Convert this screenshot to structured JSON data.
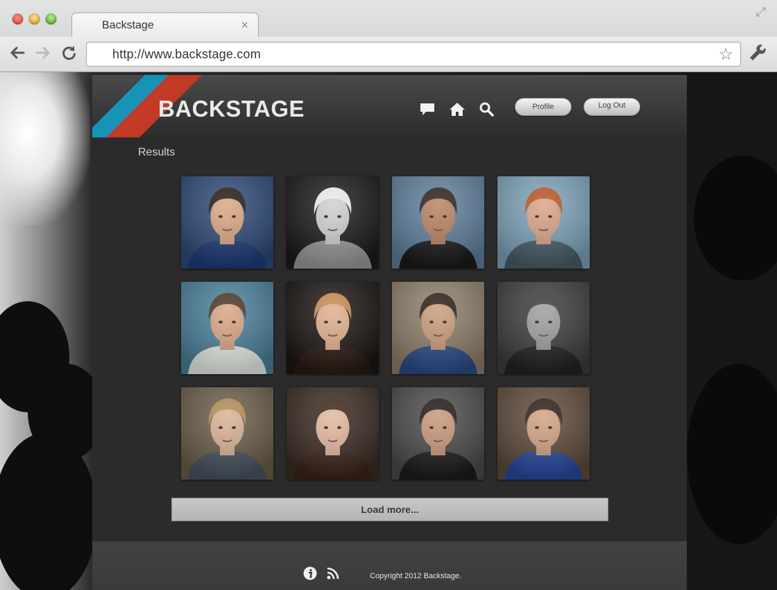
{
  "browser": {
    "tab_title": "Backstage",
    "tab_close": "×",
    "url": "http://www.backstage.com"
  },
  "header": {
    "logo": "BACKSTAGE",
    "profile_label": "Profile",
    "logout_label": "Log Out",
    "icons": [
      "chat-icon",
      "home-icon",
      "search-icon"
    ]
  },
  "main": {
    "title": "Results",
    "photos": [
      {
        "bg": "#2d4a78",
        "skin": "#d9a57f",
        "hair": "#1f1610",
        "shirt": "#1e3a78"
      },
      {
        "bg": "#1a1a1a",
        "skin": "#cfcfcf",
        "hair": "#eeeeee",
        "shirt": "#9a9a9a"
      },
      {
        "bg": "#5f7f9c",
        "skin": "#b77f5d",
        "hair": "#2a1d16",
        "shirt": "#1a1a1a"
      },
      {
        "bg": "#7da3b8",
        "skin": "#d9a283",
        "hair": "#b8531f",
        "shirt": "#4a5c68"
      },
      {
        "bg": "#4a7f99",
        "skin": "#d9a37f",
        "hair": "#4a3222",
        "shirt": "#e8efe6"
      },
      {
        "bg": "#1b1512",
        "skin": "#e0ad8a",
        "hair": "#c8874a",
        "shirt": "#2a1a14"
      },
      {
        "bg": "#8f7e6a",
        "skin": "#c99a78",
        "hair": "#261a12",
        "shirt": "#2d4c8a"
      },
      {
        "bg": "#3d3d3d",
        "skin": "#9c9c9c",
        "hair": "#3a3a3a",
        "shirt": "#222222"
      },
      {
        "bg": "#6b5d48",
        "skin": "#d8b092",
        "hair": "#b08a52",
        "shirt": "#4a5260"
      },
      {
        "bg": "#3a2a22",
        "skin": "#e2b79c",
        "hair": "#3b2417",
        "shirt": "#3b2417"
      },
      {
        "bg": "#4b4b4b",
        "skin": "#c99478",
        "hair": "#1b1411",
        "shirt": "#1c1c1c"
      },
      {
        "bg": "#5e4a3a",
        "skin": "#d0a080",
        "hair": "#2b1b12",
        "shirt": "#2748a0"
      }
    ],
    "load_more": "Load more..."
  },
  "footer": {
    "copyright": "Copyright 2012 Backstage.",
    "icons": [
      "info-icon",
      "rss-icon"
    ]
  },
  "colors": {
    "stripe_blue": "#1793b8",
    "stripe_red": "#c23a25",
    "panel": "#2b2b2b"
  }
}
